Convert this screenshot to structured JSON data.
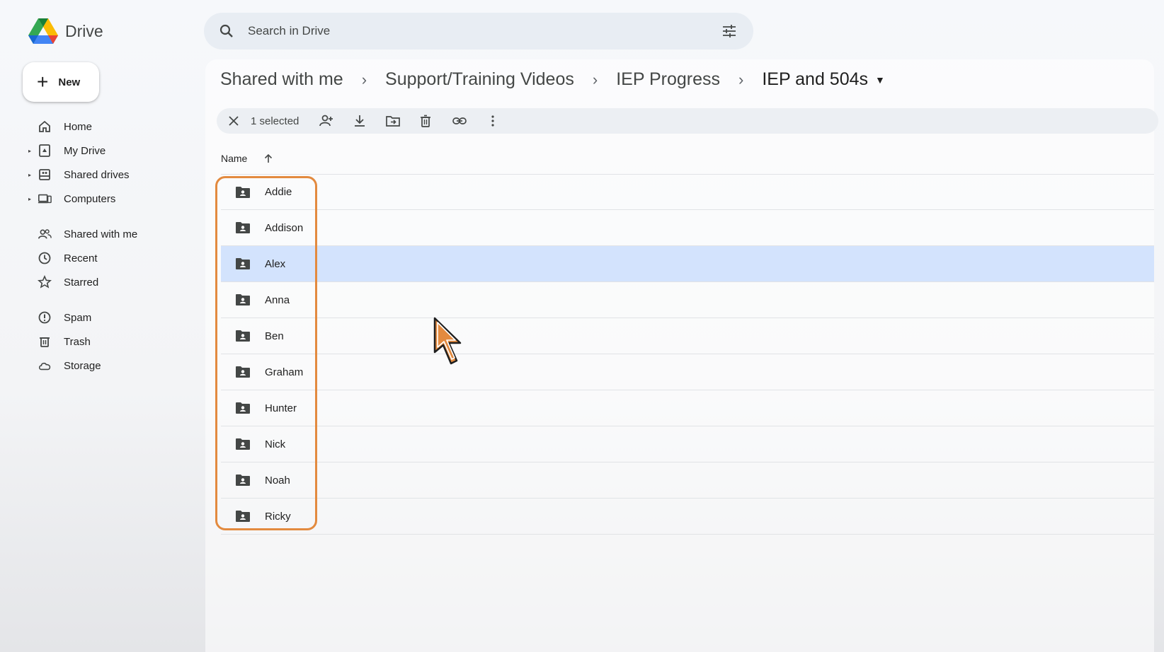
{
  "app": {
    "name": "Drive"
  },
  "sidebar": {
    "new_label": "New",
    "items": [
      {
        "label": "Home",
        "icon": "home-icon",
        "caret": false
      },
      {
        "label": "My Drive",
        "icon": "my-drive-icon",
        "caret": true
      },
      {
        "label": "Shared drives",
        "icon": "shared-drives-icon",
        "caret": true
      },
      {
        "label": "Computers",
        "icon": "computers-icon",
        "caret": true
      },
      {
        "label": "Shared with me",
        "icon": "shared-with-me-icon",
        "caret": false
      },
      {
        "label": "Recent",
        "icon": "clock-icon",
        "caret": false
      },
      {
        "label": "Starred",
        "icon": "star-icon",
        "caret": false
      },
      {
        "label": "Spam",
        "icon": "spam-icon",
        "caret": false
      },
      {
        "label": "Trash",
        "icon": "trash-icon",
        "caret": false
      },
      {
        "label": "Storage",
        "icon": "cloud-icon",
        "caret": false
      }
    ]
  },
  "search": {
    "placeholder": "Search in Drive"
  },
  "breadcrumb": [
    "Shared with me",
    "Support/Training Videos",
    "IEP Progress",
    "IEP and 504s"
  ],
  "selection": {
    "count_label": "1 selected",
    "actions": [
      "share-icon",
      "download-icon",
      "move-icon",
      "trash-icon",
      "link-icon",
      "more-vert-icon"
    ]
  },
  "list": {
    "column_name": "Name",
    "sort": "ascending",
    "rows": [
      {
        "name": "Addie",
        "selected": false
      },
      {
        "name": "Addison",
        "selected": false
      },
      {
        "name": "Alex",
        "selected": true
      },
      {
        "name": "Anna",
        "selected": false
      },
      {
        "name": "Ben",
        "selected": false
      },
      {
        "name": "Graham",
        "selected": false
      },
      {
        "name": "Hunter",
        "selected": false
      },
      {
        "name": "Nick",
        "selected": false
      },
      {
        "name": "Noah",
        "selected": false
      },
      {
        "name": "Ricky",
        "selected": false
      }
    ]
  },
  "colors": {
    "selected_row": "#d3e3fd",
    "highlight": "#e38a3f",
    "cursor": "#e38a3f"
  }
}
